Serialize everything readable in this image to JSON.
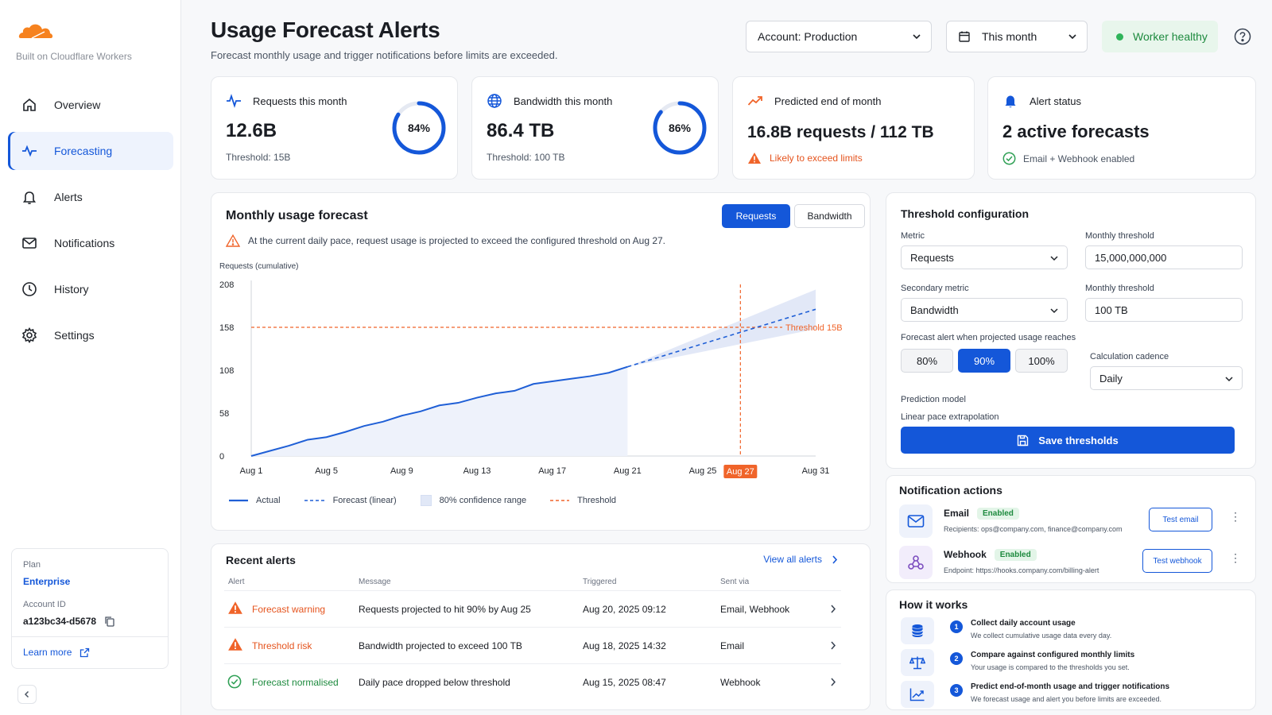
{
  "brand": {
    "caption": "Built on Cloudflare Workers",
    "logo_color": "#f6821f"
  },
  "nav": [
    {
      "label": "Overview",
      "icon": "home-icon"
    },
    {
      "label": "Forecasting",
      "icon": "pulse-icon",
      "active": true
    },
    {
      "label": "Alerts",
      "icon": "bell-icon"
    },
    {
      "label": "Notifications",
      "icon": "mail-icon"
    },
    {
      "label": "History",
      "icon": "clock-icon"
    },
    {
      "label": "Settings",
      "icon": "gear-icon"
    }
  ],
  "plan": {
    "label": "Plan",
    "value": "Enterprise",
    "account_label": "Account ID",
    "account_id": "a123bc34-d5678",
    "learn_more": "Learn more"
  },
  "header": {
    "title": "Usage Forecast Alerts",
    "subtitle": "Forecast monthly usage and trigger notifications before limits are exceeded.",
    "account_select": "Account: Production",
    "period_select": "This month",
    "status": "Worker healthy"
  },
  "kpis": {
    "requests": {
      "label": "Requests this month",
      "value": "12.6B",
      "threshold": "Threshold:  15B",
      "percent": 84,
      "percent_label": "84%"
    },
    "bandwidth": {
      "label": "Bandwidth this month",
      "value": "86.4 TB",
      "threshold": "Threshold:  100 TB",
      "percent": 86,
      "percent_label": "86%"
    },
    "predicted": {
      "label": "Predicted end of month",
      "value": "16.8B requests  /  112 TB",
      "warning": "Likely to exceed limits"
    },
    "alert_status": {
      "label": "Alert status",
      "value": "2  active forecasts",
      "note": "Email + Webhook enabled"
    }
  },
  "forecast": {
    "title": "Monthly usage forecast",
    "toggle": [
      "Requests",
      "Bandwidth"
    ],
    "warning": "At the current daily pace, request usage is projected to exceed the configured threshold on Aug 27.",
    "legend": {
      "actual": "Actual",
      "forecast": "Forecast (linear)",
      "confidence": "80% confidence range",
      "threshold": "Threshold"
    },
    "threshold_label": "Threshold 15B"
  },
  "chart_data": {
    "type": "line",
    "ylabel": "Requests (cumulative)",
    "y_ticks": [
      "0",
      "58",
      "108",
      "158",
      "208"
    ],
    "ylim": [
      0,
      20
    ],
    "x_ticks": [
      "Aug 1",
      "Aug 5",
      "Aug 9",
      "Aug 13",
      "Aug 17",
      "Aug 21",
      "Aug 25",
      "Aug 27",
      "Aug 31"
    ],
    "highlight_tick": "Aug 27",
    "threshold": 15,
    "series": [
      {
        "name": "Actual",
        "color": "#1f5fd6",
        "x": [
          1,
          2,
          3,
          4,
          5,
          6,
          7,
          8,
          9,
          10,
          11,
          12,
          13,
          14,
          15,
          16,
          17,
          18,
          19,
          20,
          21
        ],
        "y": [
          0.0,
          0.6,
          1.2,
          1.9,
          2.2,
          2.8,
          3.5,
          4.0,
          4.7,
          5.2,
          5.9,
          6.2,
          6.8,
          7.3,
          7.6,
          8.4,
          8.7,
          9.0,
          9.3,
          9.7,
          10.4
        ]
      },
      {
        "name": "Forecast (linear)",
        "color": "#1f5fd6",
        "x": [
          21,
          31
        ],
        "y": [
          10.4,
          17.1
        ]
      }
    ],
    "confidence": {
      "x": [
        21,
        31
      ],
      "lower": [
        10.4,
        14.8
      ],
      "upper": [
        10.4,
        19.4
      ]
    }
  },
  "recent_alerts": {
    "title": "Recent alerts",
    "view_all": "View all alerts",
    "columns": [
      "Alert",
      "Message",
      "Triggered",
      "Sent via"
    ],
    "rows": [
      {
        "alert": "Forecast warning",
        "message": "Requests projected to hit 90% by Aug 25",
        "triggered": "Aug 20, 2025 09:12",
        "via": "Email, Webhook",
        "kind": "warning"
      },
      {
        "alert": "Threshold risk",
        "message": "Bandwidth projected to exceed 100 TB",
        "triggered": "Aug 18, 2025 14:32",
        "via": "Email",
        "kind": "warning"
      },
      {
        "alert": "Forecast normalised",
        "message": "Daily pace dropped below threshold",
        "triggered": "Aug 15, 2025 08:47",
        "via": "Webhook",
        "kind": "ok"
      }
    ]
  },
  "threshold_config": {
    "title": "Threshold configuration",
    "metric_label": "Metric",
    "metric": "Requests",
    "monthly_label": "Monthly threshold",
    "monthly_value": "15,000,000,000",
    "secondary_label": "Secondary metric",
    "secondary": "Bandwidth",
    "monthly_label_2": "Monthly threshold",
    "monthly_value_2": "100 TB",
    "alert_when": "Forecast alert when projected usage reaches",
    "percent_options": [
      "80%",
      "90%",
      "100%"
    ],
    "selected_percent": "90%",
    "cadence_label": "Calculation cadence",
    "cadence": "Daily",
    "model_label": "Prediction model",
    "model": "Linear pace extrapolation",
    "save": "Save thresholds"
  },
  "notification_actions": {
    "title": "Notification actions",
    "email": {
      "name": "Email",
      "status": "Enabled",
      "detail": "Recipients: ops@company.com, finance@company.com",
      "button": "Test email"
    },
    "webhook": {
      "name": "Webhook",
      "status": "Enabled",
      "detail": "Endpoint: https://hooks.company.com/billing-alert",
      "button": "Test webhook"
    }
  },
  "how_it_works": {
    "title": "How it works",
    "steps": [
      {
        "num": "1",
        "title": "Collect daily account usage",
        "desc": "We collect cumulative usage data every day."
      },
      {
        "num": "2",
        "title": "Compare against configured monthly limits",
        "desc": "Your usage is compared to the thresholds you set."
      },
      {
        "num": "3",
        "title": "Predict end-of-month usage and trigger notifications",
        "desc": "We forecast usage and alert you before limits are exceeded."
      }
    ]
  }
}
